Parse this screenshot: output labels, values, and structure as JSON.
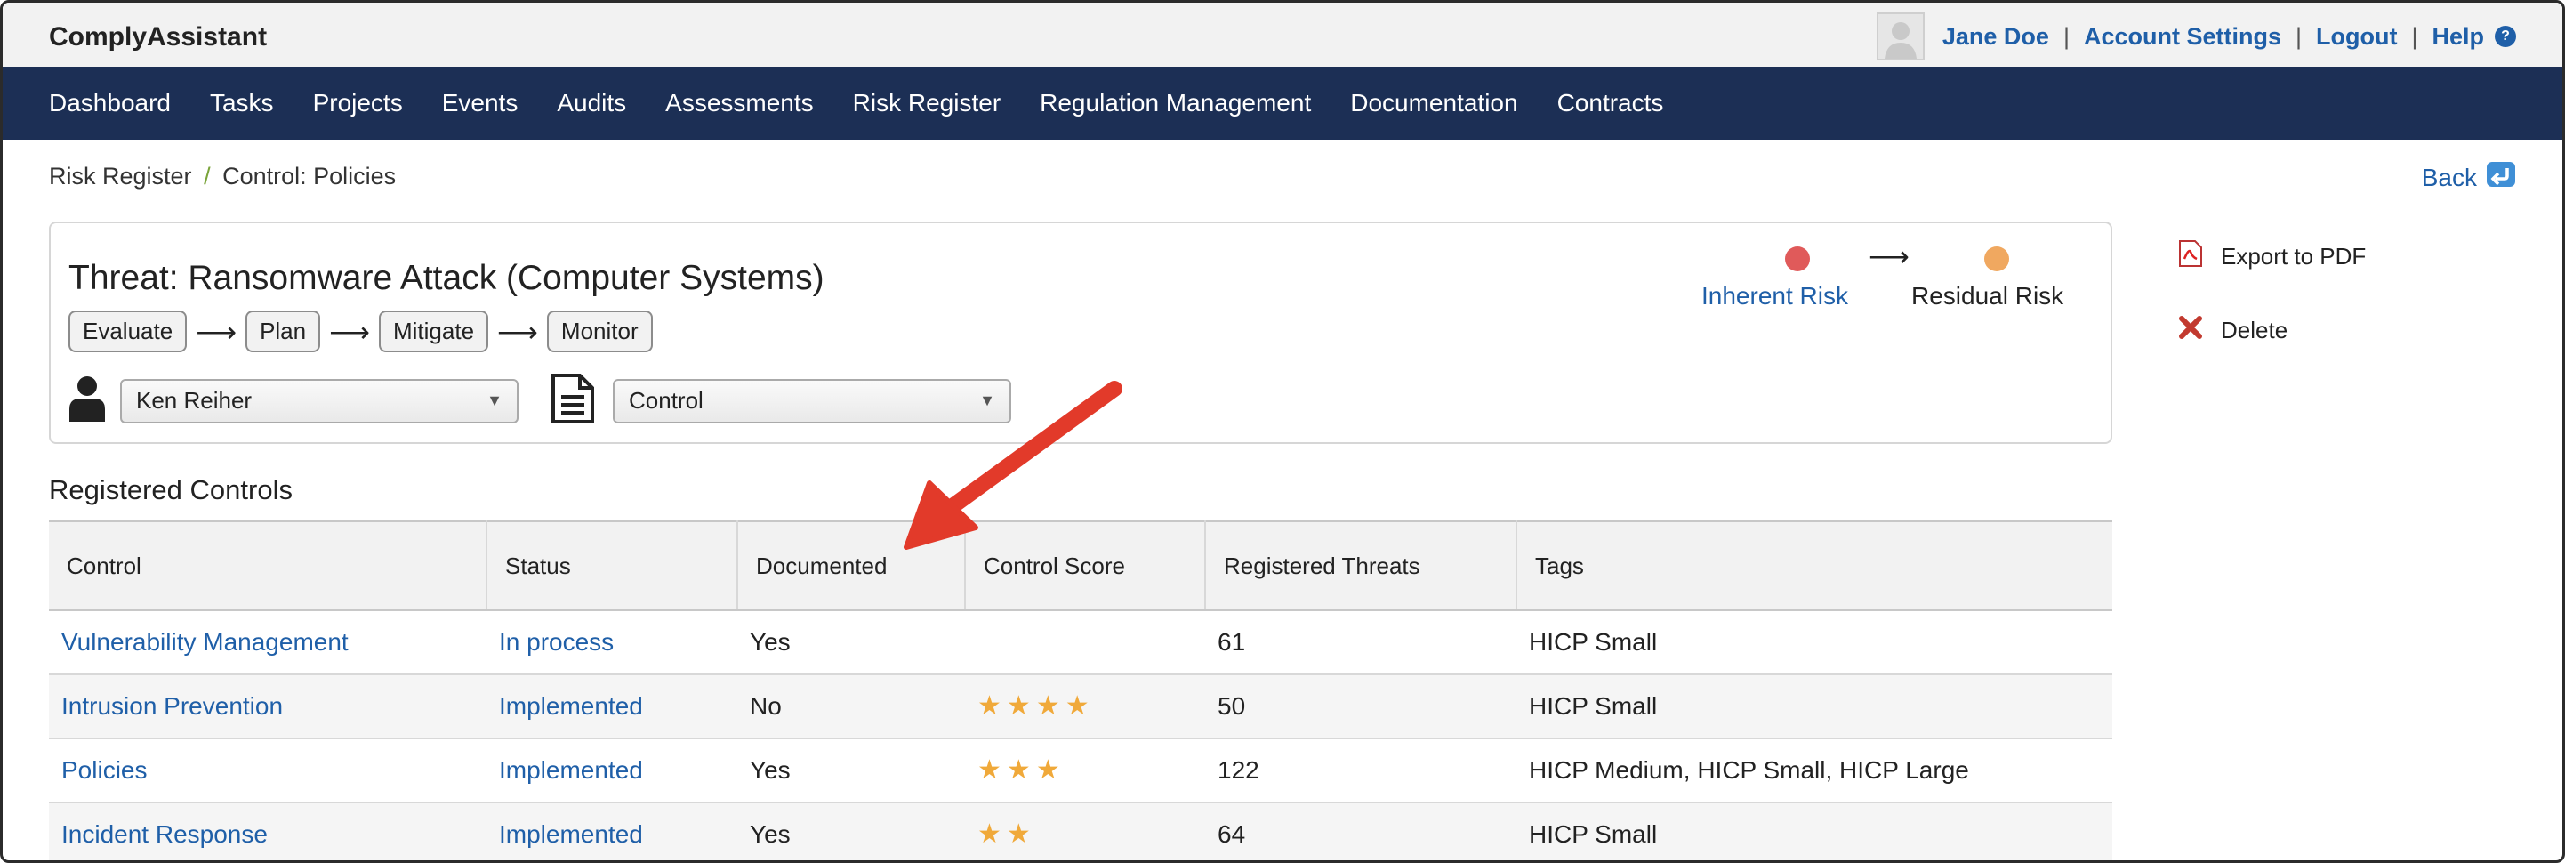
{
  "app": {
    "title": "ComplyAssistant"
  },
  "user_menu": {
    "user_name": "Jane Doe",
    "account_settings": "Account Settings",
    "logout": "Logout",
    "help": "Help",
    "help_icon": "?"
  },
  "nav": {
    "items": [
      "Dashboard",
      "Tasks",
      "Projects",
      "Events",
      "Audits",
      "Assessments",
      "Risk Register",
      "Regulation Management",
      "Documentation",
      "Contracts"
    ]
  },
  "breadcrumb": {
    "parent": "Risk Register",
    "separator": "/",
    "current": "Control: Policies"
  },
  "back": {
    "label": "Back"
  },
  "threat": {
    "title": "Threat: Ransomware Attack (Computer Systems)",
    "stages": [
      "Evaluate",
      "Plan",
      "Mitigate",
      "Monitor"
    ],
    "owner": "Ken Reiher",
    "type": "Control",
    "inherent_risk_label": "Inherent Risk",
    "residual_risk_label": "Residual Risk",
    "inherent_color": "#e05a5a",
    "residual_color": "#f0a860"
  },
  "side_actions": {
    "export": "Export to PDF",
    "delete": "Delete"
  },
  "controls": {
    "section_title": "Registered Controls",
    "columns": [
      "Control",
      "Status",
      "Documented",
      "Control Score",
      "Registered Threats",
      "Tags"
    ],
    "rows": [
      {
        "control": "Vulnerability Management",
        "status": "In process",
        "documented": "Yes",
        "score": 0,
        "threats": "61",
        "tags": "HICP Small"
      },
      {
        "control": "Intrusion Prevention",
        "status": "Implemented",
        "documented": "No",
        "score": 4,
        "threats": "50",
        "tags": "HICP Small"
      },
      {
        "control": "Policies",
        "status": "Implemented",
        "documented": "Yes",
        "score": 3,
        "threats": "122",
        "tags": "HICP Medium, HICP Small, HICP Large"
      },
      {
        "control": "Incident Response",
        "status": "Implemented",
        "documented": "Yes",
        "score": 2,
        "threats": "64",
        "tags": "HICP Small"
      }
    ]
  },
  "colors": {
    "nav_bg": "#1c2f55",
    "link": "#1f5fa8",
    "star": "#f0a93a",
    "annotation": "#e23a2a"
  }
}
